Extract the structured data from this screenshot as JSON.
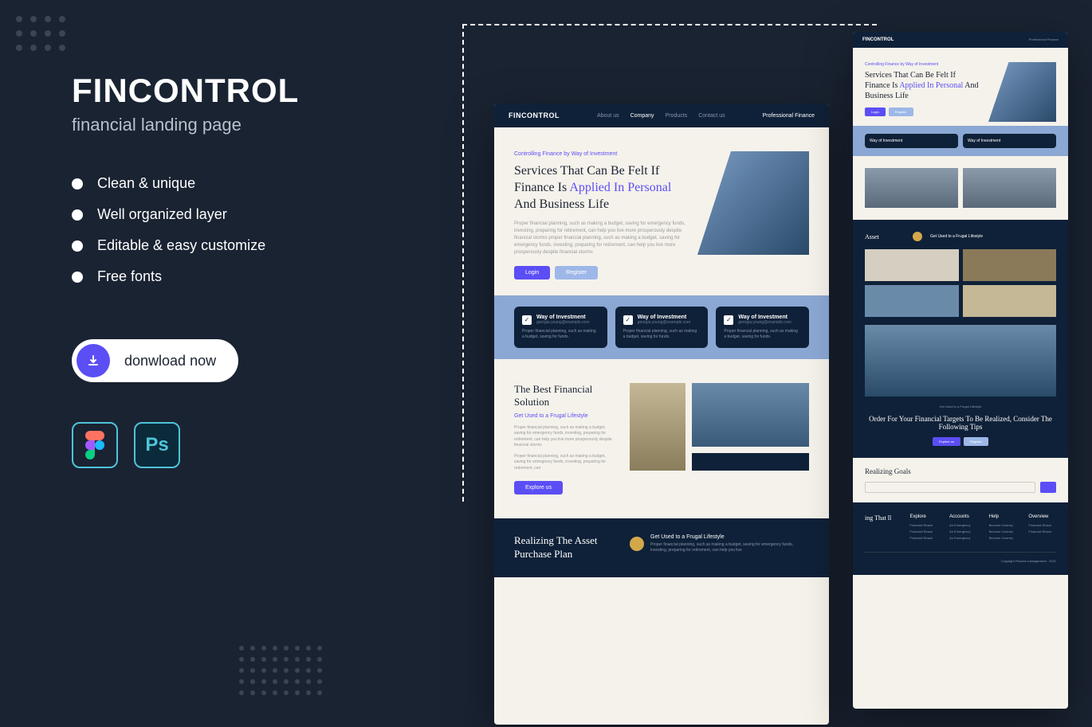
{
  "promo": {
    "title": "FINCONTROL",
    "subtitle": "financial landing page",
    "features": [
      "Clean & unique",
      "Well organized layer",
      "Editable & easy customize",
      "Free fonts"
    ],
    "download_label": "donwload now",
    "icons": {
      "figma": "Figma",
      "ps": "Ps"
    }
  },
  "mockup": {
    "brand": "FINCONTROL",
    "nav": {
      "about": "About us",
      "company": "Company",
      "products": "Products",
      "contact": "Contact us"
    },
    "header_cta": "Professional Finance",
    "hero": {
      "eyebrow": "Controlling Finance by Way of Investment",
      "headline_1": "Services That Can Be Felt If Finance Is ",
      "headline_hl": "Applied In Personal",
      "headline_2": " And Business Life",
      "desc": "Proper financial planning, such as making a budget, saving for emergency funds, investing, preparing for retirement, can help you live more prosperously despite financial storms proper financial planning, such as making a budget, saving for emergency funds, investing, preparing for retirement, can help you live more prosperously despite financial storms",
      "login": "Login",
      "register": "Register"
    },
    "cards": [
      {
        "title": "Way of Investment",
        "sub": "georgia.young@example.com",
        "desc": "Proper financial planning, such as making a budget, saving for funds."
      },
      {
        "title": "Way of Investment",
        "sub": "georgia.young@example.com",
        "desc": "Proper financial planning, such as making a budget, saving for funds."
      },
      {
        "title": "Way of Investment",
        "sub": "georgia.young@example.com",
        "desc": "Proper financial planning, such as making a budget, saving for funds."
      }
    ],
    "solution": {
      "title": "The Best Financial Solution",
      "sub": "Get Used to a Frugal Lifestyle",
      "desc1": "Proper financial planning, such as making a budget, saving for emergency funds, investing, preparing for retirement, can help you live more prosperously despite financial storms",
      "desc2": "Proper financial planning, such as making a budget, saving for emergency funds, investing, preparing for retirement, can",
      "btn": "Explore us"
    },
    "asset": {
      "title": "Realizing The Asset Purchase Plan",
      "sub": "Get Used to a Frugal Lifestyle",
      "desc": "Proper financial planning, such as making a budget, saving for emergency funds, investing, preparing for retirement, can help you live"
    },
    "side": {
      "asset_label": "Asset",
      "tips_eyebrow": "Get Used to a Frugal Lifestyle",
      "tips_title": "Order For Your Financial Targets To Be Realized, Consider The Following Tips",
      "goals_title": "Realizing Goals",
      "footer_title": "ing That ll",
      "cols": {
        "explore": {
          "h": "Explore",
          "l1": "Financial Reach",
          "l2": "Financial Reach",
          "l3": "Financial Reach"
        },
        "accounts": {
          "h": "Accounts",
          "l1": "An Emergency",
          "l2": "An Emergency",
          "l3": "An Emergency"
        },
        "help": {
          "h": "Help",
          "l1": "Become Journey",
          "l2": "Become Journey",
          "l3": "Become Journey"
        },
        "overview": {
          "h": "Overview",
          "l1": "Financial Reach",
          "l2": "Financial Reach"
        }
      },
      "copy": "Copyright Finance management - 2021"
    }
  }
}
